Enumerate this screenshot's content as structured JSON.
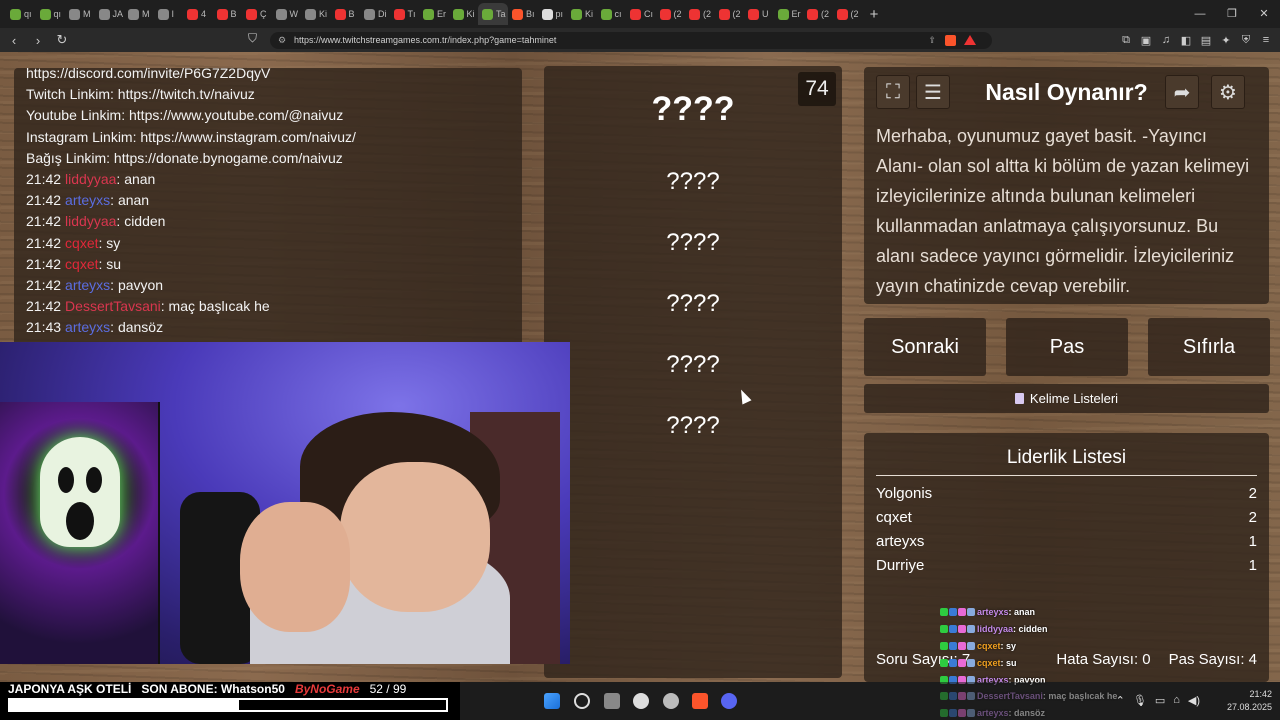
{
  "browser": {
    "tabs": [
      {
        "label": "qı",
        "color": "#6aaa3a"
      },
      {
        "label": "qı",
        "color": "#6aaa3a"
      },
      {
        "label": "M",
        "color": "#888"
      },
      {
        "label": "JA",
        "color": "#888"
      },
      {
        "label": "M",
        "color": "#888"
      },
      {
        "label": "I",
        "color": "#888"
      },
      {
        "label": "4",
        "color": "#e33"
      },
      {
        "label": "B",
        "color": "#e33"
      },
      {
        "label": "Ç",
        "color": "#e33"
      },
      {
        "label": "W",
        "color": "#888"
      },
      {
        "label": "Ki",
        "color": "#888"
      },
      {
        "label": "B",
        "color": "#e33"
      },
      {
        "label": "Di",
        "color": "#888"
      },
      {
        "label": "Tı",
        "color": "#e33"
      },
      {
        "label": "Er",
        "color": "#6aaa3a"
      },
      {
        "label": "Ki",
        "color": "#6aaa3a"
      },
      {
        "label": "Ta",
        "color": "#6aaa3a",
        "active": true
      },
      {
        "label": "Bı",
        "color": "#fb542b"
      },
      {
        "label": "pı",
        "color": "#ddd"
      },
      {
        "label": "Ki",
        "color": "#6aaa3a"
      },
      {
        "label": "cı",
        "color": "#6aaa3a"
      },
      {
        "label": "Cı",
        "color": "#e33"
      },
      {
        "label": "(2",
        "color": "#e33"
      },
      {
        "label": "(2",
        "color": "#e33"
      },
      {
        "label": "(2",
        "color": "#e33"
      },
      {
        "label": "U",
        "color": "#e33"
      },
      {
        "label": "Er",
        "color": "#6aaa3a"
      },
      {
        "label": "(2",
        "color": "#e33"
      },
      {
        "label": "(2",
        "color": "#e33"
      }
    ],
    "new_tab": "+",
    "tab_close": "✕",
    "window": {
      "minimize": "—",
      "maximize": "❐",
      "close": "✕"
    },
    "url": "https://www.twitchstreamgames.com.tr/index.php?game=tahminet",
    "nav": {
      "back": "‹",
      "forward": "›",
      "reload": "↻",
      "bookmark": "⛉"
    }
  },
  "chat": {
    "info_lines": [
      "https://discord.com/invite/P6G7Z2DqyV",
      "Twitch Linkim: https://twitch.tv/naivuz",
      "Youtube Linkim: https://www.youtube.com/@naivuz",
      "Instagram Linkim: https://www.instagram.com/naivuz/",
      "Bağış Linkim: https://donate.bynogame.com/naivuz"
    ],
    "messages": [
      {
        "time": "21:42",
        "user": "liddyyaa",
        "text": ": anan",
        "cls": "n-liddyyaa"
      },
      {
        "time": "21:42",
        "user": "arteyxs",
        "text": ": anan",
        "cls": "n-arteyxs"
      },
      {
        "time": "21:42",
        "user": "liddyyaa",
        "text": ": cidden",
        "cls": "n-liddyyaa"
      },
      {
        "time": "21:42",
        "user": "cqxet",
        "text": ": sy",
        "cls": "n-cqxet"
      },
      {
        "time": "21:42",
        "user": "cqxet",
        "text": ": su",
        "cls": "n-cqxet"
      },
      {
        "time": "21:42",
        "user": "arteyxs",
        "text": ": pavyon",
        "cls": "n-arteyxs"
      },
      {
        "time": "21:42",
        "user": "DessertTavsani",
        "text": ": maç başlıcak he",
        "cls": "n-dessert"
      },
      {
        "time": "21:43",
        "user": "arteyxs",
        "text": ": dansöz",
        "cls": "n-arteyxs"
      }
    ]
  },
  "game": {
    "counter": "74",
    "main_word": "????",
    "forbidden_words": [
      "????",
      "????",
      "????",
      "????",
      "????"
    ],
    "howto": {
      "title": "Nasıl Oynanır?",
      "text": "Merhaba, oyunumuz gayet basit. -Yayıncı Alanı- olan sol altta ki bölüm de yazan kelimeyi izleyicilerinize altında bulunan kelimeleri kullanmadan anlatmaya çalışıyorsunuz. Bu alanı sadece yayıncı görmelidir. İzleyicileriniz yayın chatinizde cevap verebilir.",
      "icons": [
        "fullscreen-icon",
        "list-icon",
        "exit-icon",
        "gear-icon"
      ]
    },
    "buttons": {
      "next": "Sonraki",
      "pass": "Pas",
      "reset": "Sıfırla"
    },
    "word_lists": "Kelime Listeleri",
    "leaderboard": {
      "title": "Liderlik Listesi",
      "rows": [
        {
          "name": "Yolgonis",
          "score": "2"
        },
        {
          "name": "cqxet",
          "score": "2"
        },
        {
          "name": "arteyxs",
          "score": "1"
        },
        {
          "name": "Durriye",
          "score": "1"
        }
      ]
    },
    "stats": {
      "question": "Soru Sayısı: 7",
      "errors": "Hata Sayısı: 0",
      "passes": "Pas Sayısı: 4"
    }
  },
  "overlay_chat": [
    {
      "user": "arteyxs",
      "text": " : anan",
      "color": "#c48ae8"
    },
    {
      "user": "liddyyaa",
      "text": " : cidden",
      "color": "#c48ae8"
    },
    {
      "user": "cqxet",
      "text": " : sy",
      "color": "#f0a020"
    },
    {
      "user": "cqxet",
      "text": " : su",
      "color": "#f0a020"
    },
    {
      "user": "arteyxs",
      "text": " : pavyon",
      "color": "#c48ae8"
    },
    {
      "user": "DessertTavsani",
      "text": " : maç başlıcak he",
      "color": "#c48ae8"
    },
    {
      "user": "arteyxs",
      "text": " : dansöz",
      "color": "#c48ae8"
    }
  ],
  "stream_bar": {
    "show_text": "JAPONYA AŞK OTELİ",
    "sub_text": "SON ABONE: Whatson50",
    "logo": "ByNoGame",
    "count": "52  /  99",
    "progress": 0.525
  },
  "taskbar": {
    "time": "21:42",
    "date": "27.08.2025"
  }
}
